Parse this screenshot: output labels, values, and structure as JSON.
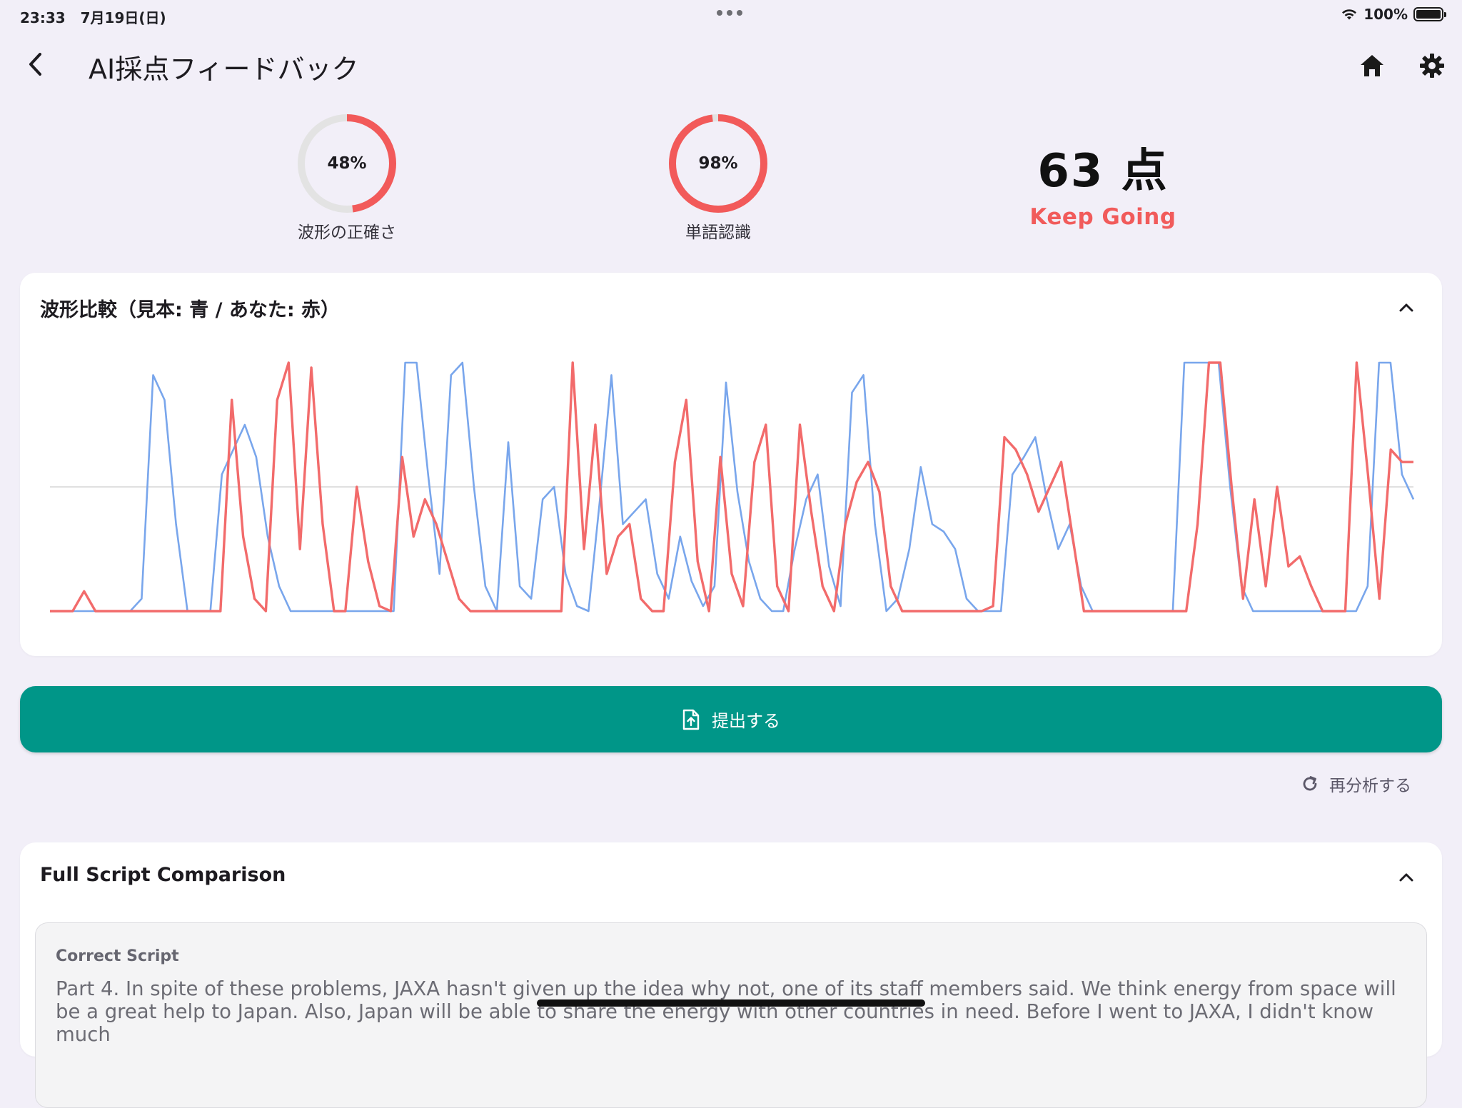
{
  "status_bar": {
    "time": "23:33",
    "date": "7月19日(日)",
    "battery": "100%",
    "battery_level": 1.0
  },
  "header": {
    "title": "AI採点フィードバック",
    "back_icon": "chevron-left-icon",
    "home_icon": "home-icon",
    "settings_icon": "gear-icon"
  },
  "metrics": {
    "waveform_accuracy": {
      "value_text": "48%",
      "fraction": 0.48,
      "label": "波形の正確さ"
    },
    "word_recognition": {
      "value_text": "98%",
      "fraction": 0.98,
      "label": "単語認識"
    },
    "score": {
      "value_text": "63 点",
      "status": "Keep Going"
    }
  },
  "colors": {
    "accent_red": "#f25a5a",
    "ring_track": "#e3e3e3",
    "teal": "#009688",
    "model_wave_blue": "#79a6ec",
    "user_wave_red": "#f26b6b",
    "background": "#f2eff8"
  },
  "waveform_card": {
    "title": "波形比較（見本: 青 / あなた: 赤）",
    "collapse_icon": "chevron-up-icon"
  },
  "chart_data": {
    "type": "line",
    "title": "",
    "xlabel": "",
    "ylabel": "",
    "grid": false,
    "ylim": [
      0,
      1
    ],
    "x_count": 120,
    "series": [
      {
        "name": "見本",
        "color": "#79a6ec",
        "values": [
          0,
          0,
          0,
          0,
          0,
          0,
          0,
          0,
          0.05,
          0.95,
          0.85,
          0.35,
          0,
          0,
          0,
          0.55,
          0.65,
          0.75,
          0.62,
          0.3,
          0.1,
          0,
          0,
          0,
          0,
          0,
          0,
          0,
          0,
          0,
          0,
          1,
          1,
          0.55,
          0.15,
          0.95,
          1,
          0.5,
          0.1,
          0,
          0.68,
          0.1,
          0.05,
          0.45,
          0.5,
          0.15,
          0.02,
          0,
          0.45,
          0.95,
          0.35,
          0.4,
          0.45,
          0.15,
          0.05,
          0.3,
          0.12,
          0.02,
          0.1,
          0.92,
          0.48,
          0.2,
          0.05,
          0,
          0,
          0.25,
          0.45,
          0.55,
          0.18,
          0.02,
          0.88,
          0.95,
          0.35,
          0,
          0.05,
          0.25,
          0.58,
          0.35,
          0.32,
          0.25,
          0.05,
          0,
          0,
          0,
          0.55,
          0.62,
          0.7,
          0.45,
          0.25,
          0.35,
          0.1,
          0,
          0,
          0,
          0,
          0,
          0,
          0,
          0,
          1,
          1,
          1,
          1,
          0.5,
          0.1,
          0,
          0,
          0,
          0,
          0,
          0,
          0,
          0,
          0,
          0,
          0.1,
          1,
          1,
          0.55,
          0.45
        ]
      },
      {
        "name": "あなた",
        "color": "#f26b6b",
        "values": [
          0,
          0,
          0,
          0.08,
          0,
          0,
          0,
          0,
          0,
          0,
          0,
          0,
          0,
          0,
          0,
          0,
          0.85,
          0.3,
          0.05,
          0,
          0.85,
          1,
          0.25,
          0.98,
          0.35,
          0,
          0,
          0.5,
          0.2,
          0.02,
          0,
          0.62,
          0.3,
          0.45,
          0.35,
          0.2,
          0.05,
          0,
          0,
          0,
          0,
          0,
          0,
          0,
          0,
          0,
          1,
          0.25,
          0.75,
          0.15,
          0.3,
          0.35,
          0.05,
          0,
          0,
          0.6,
          0.85,
          0.2,
          0,
          0.62,
          0.15,
          0.02,
          0.6,
          0.75,
          0.1,
          0,
          0.75,
          0.4,
          0.1,
          0,
          0.35,
          0.52,
          0.6,
          0.48,
          0.1,
          0,
          0,
          0,
          0,
          0,
          0,
          0,
          0,
          0.02,
          0.7,
          0.65,
          0.55,
          0.4,
          0.5,
          0.6,
          0.3,
          0,
          0,
          0,
          0,
          0,
          0,
          0,
          0,
          0,
          0,
          0.35,
          1,
          1,
          0.5,
          0.05,
          0.45,
          0.1,
          0.5,
          0.18,
          0.22,
          0.1,
          0,
          0,
          0,
          1,
          0.55,
          0.05,
          0.65,
          0.6,
          0.6
        ]
      }
    ]
  },
  "actions": {
    "submit_label": "提出する",
    "submit_icon": "file-upload-icon",
    "reanalyze_label": "再分析する",
    "reanalyze_icon": "refresh-icon"
  },
  "script_card": {
    "title": "Full Script Comparison",
    "collapse_icon": "chevron-up-icon",
    "correct_label": "Correct Script",
    "correct_text": "Part 4. In spite of these problems, JAXA hasn't given up the idea why not, one of its staff members said. We think energy from space will be a great help to Japan. Also, Japan will be able to share the energy with other countries in need. Before I went to JAXA, I didn't know much"
  }
}
